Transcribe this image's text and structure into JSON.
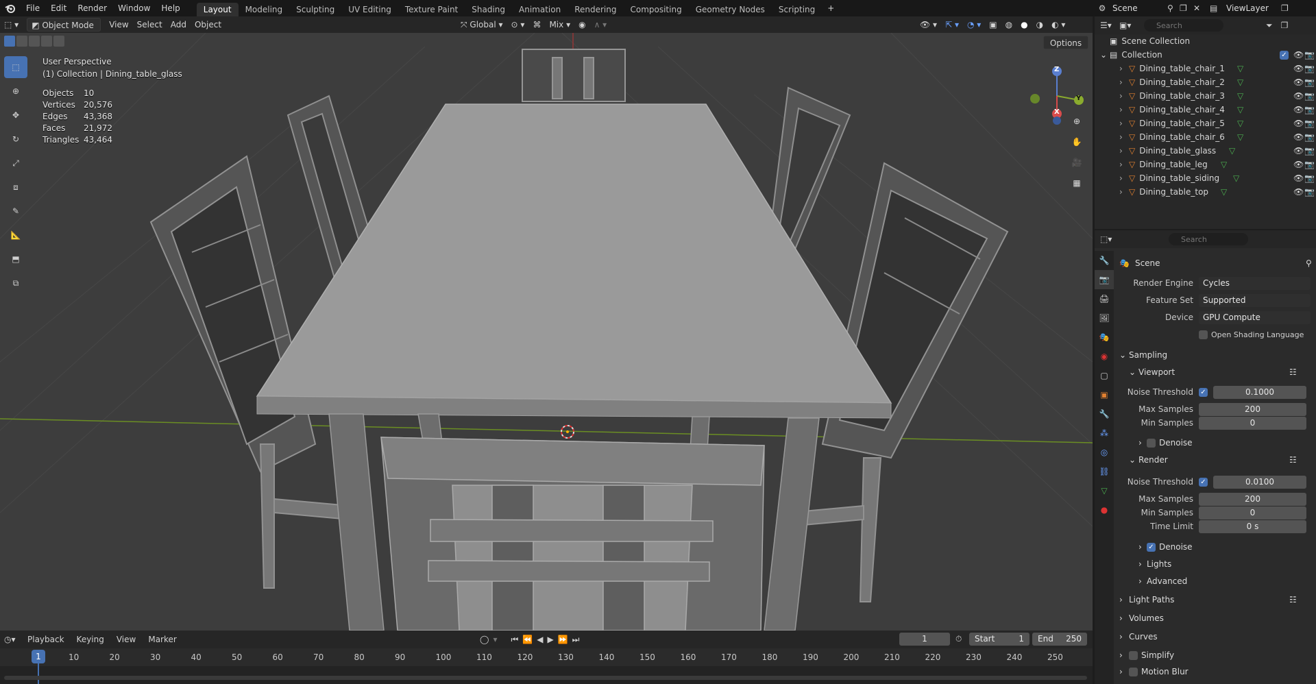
{
  "topbar": {
    "menus": [
      "File",
      "Edit",
      "Render",
      "Window",
      "Help"
    ],
    "workspaces": [
      "Layout",
      "Modeling",
      "Sculpting",
      "UV Editing",
      "Texture Paint",
      "Shading",
      "Animation",
      "Rendering",
      "Compositing",
      "Geometry Nodes",
      "Scripting"
    ],
    "active_workspace": "Layout",
    "add_tab": "+",
    "scene_name": "Scene",
    "view_layer": "ViewLayer"
  },
  "viewport_header": {
    "mode": "Object Mode",
    "menus": [
      "View",
      "Select",
      "Add",
      "Object"
    ],
    "orientation": "Global",
    "snap": "Mix",
    "options": "Options"
  },
  "viewport": {
    "perspective": "User Perspective",
    "context": "(1) Collection | Dining_table_glass",
    "stats": [
      {
        "label": "Objects",
        "value": "10"
      },
      {
        "label": "Vertices",
        "value": "20,576"
      },
      {
        "label": "Edges",
        "value": "43,368"
      },
      {
        "label": "Faces",
        "value": "21,972"
      },
      {
        "label": "Triangles",
        "value": "43,464"
      }
    ],
    "gizmo": {
      "z": "Z",
      "y": "Y",
      "x": "X"
    }
  },
  "outliner": {
    "search_placeholder": "Search",
    "scene_collection": "Scene Collection",
    "collection": "Collection",
    "objects": [
      "Dining_table_chair_1",
      "Dining_table_chair_2",
      "Dining_table_chair_3",
      "Dining_table_chair_4",
      "Dining_table_chair_5",
      "Dining_table_chair_6",
      "Dining_table_glass",
      "Dining_table_leg",
      "Dining_table_siding",
      "Dining_table_top"
    ]
  },
  "properties": {
    "search_placeholder": "Search",
    "context": "Scene",
    "render_engine_label": "Render Engine",
    "render_engine": "Cycles",
    "feature_set_label": "Feature Set",
    "feature_set": "Supported",
    "device_label": "Device",
    "device": "GPU Compute",
    "osl": "Open Shading Language",
    "sampling": "Sampling",
    "viewport": "Viewport",
    "render": "Render",
    "noise_threshold_label": "Noise Threshold",
    "viewport_noise": "0.1000",
    "max_samples_label": "Max Samples",
    "viewport_max": "200",
    "min_samples_label": "Min Samples",
    "viewport_min": "0",
    "denoise": "Denoise",
    "render_noise": "0.0100",
    "render_max": "200",
    "render_min": "0",
    "time_limit_label": "Time Limit",
    "time_limit": "0 s",
    "lights": "Lights",
    "advanced": "Advanced",
    "light_paths": "Light Paths",
    "volumes": "Volumes",
    "curves": "Curves",
    "simplify": "Simplify",
    "motion_blur": "Motion Blur"
  },
  "timeline": {
    "menus": [
      "Playback",
      "Keying",
      "View",
      "Marker"
    ],
    "current_frame": "1",
    "start_label": "Start",
    "start": "1",
    "end_label": "End",
    "end": "250",
    "ticks": [
      "10",
      "20",
      "30",
      "40",
      "50",
      "60",
      "70",
      "80",
      "90",
      "100",
      "110",
      "120",
      "130",
      "140",
      "150",
      "160",
      "170",
      "180",
      "190",
      "200",
      "210",
      "220",
      "230",
      "240",
      "250"
    ],
    "playhead": "1"
  },
  "colors": {
    "accent": "#4772b3",
    "viewport_bg": "#3d3d3d",
    "mesh": "#9a9a9a"
  }
}
